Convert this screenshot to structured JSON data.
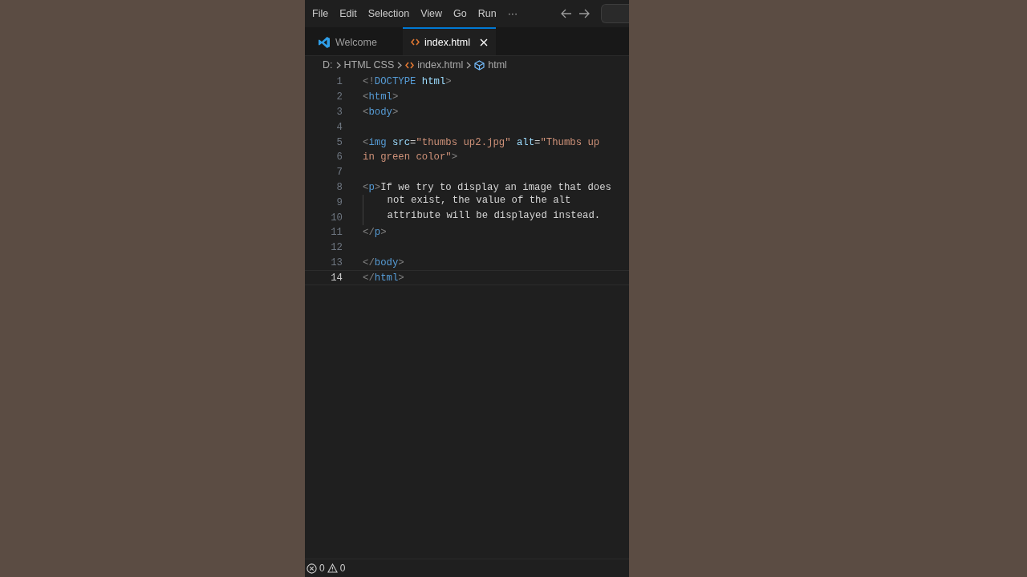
{
  "menu": [
    {
      "label": "File"
    },
    {
      "label": "Edit"
    },
    {
      "label": "Selection"
    },
    {
      "label": "View"
    },
    {
      "label": "Go"
    },
    {
      "label": "Run"
    },
    {
      "label": "···"
    }
  ],
  "tabs": [
    {
      "label": "Welcome",
      "kind": "welcome",
      "selected": false
    },
    {
      "label": "index.html",
      "kind": "html",
      "selected": true
    }
  ],
  "breadcrumb": [
    {
      "label": "D:",
      "kind": "folder"
    },
    {
      "label": "HTML CSS",
      "kind": "folder"
    },
    {
      "label": "index.html",
      "kind": "html"
    },
    {
      "label": "html",
      "kind": "element"
    }
  ],
  "lines": [
    {
      "number": "1",
      "current": false,
      "tokens": [
        {
          "kind": "bracket",
          "text": "<!"
        },
        {
          "kind": "tag",
          "text": "DOCTYPE"
        },
        {
          "kind": "attr",
          "text": " html"
        },
        {
          "kind": "bracket",
          "text": ">"
        }
      ]
    },
    {
      "number": "2",
      "current": false,
      "tokens": [
        {
          "kind": "bracket",
          "text": "<"
        },
        {
          "kind": "tag",
          "text": "html"
        },
        {
          "kind": "bracket",
          "text": ">"
        }
      ]
    },
    {
      "number": "3",
      "current": false,
      "tokens": [
        {
          "kind": "bracket",
          "text": "<"
        },
        {
          "kind": "tag",
          "text": "body"
        },
        {
          "kind": "bracket",
          "text": ">"
        }
      ]
    },
    {
      "number": "4",
      "current": false
    },
    {
      "number": "5",
      "current": false,
      "tokens": [
        {
          "kind": "bracket",
          "text": "<"
        },
        {
          "kind": "tag",
          "text": "img"
        },
        {
          "kind": "attr",
          "text": " src"
        },
        {
          "kind": "text",
          "text": "="
        },
        {
          "kind": "string",
          "text": "\"thumbs up2.jpg\""
        },
        {
          "kind": "attr",
          "text": " alt"
        },
        {
          "kind": "text",
          "text": "="
        },
        {
          "kind": "string",
          "text": "\"Thumbs up"
        }
      ]
    },
    {
      "number": "6",
      "current": false,
      "tokens": [
        {
          "kind": "string",
          "text": "in green color\""
        },
        {
          "kind": "bracket",
          "text": ">"
        }
      ]
    },
    {
      "number": "7",
      "current": false
    },
    {
      "number": "8",
      "current": false,
      "tokens": [
        {
          "kind": "bracket",
          "text": "<"
        },
        {
          "kind": "tag",
          "text": "p"
        },
        {
          "kind": "bracket",
          "text": ">"
        },
        {
          "kind": "text",
          "text": "If we try to display an image that does"
        }
      ]
    },
    {
      "number": "9",
      "current": false,
      "indented": true,
      "tokens": [
        {
          "kind": "text",
          "text": "not exist, the value of the alt"
        }
      ]
    },
    {
      "number": "10",
      "current": false,
      "indented": true,
      "tokens": [
        {
          "kind": "text",
          "text": "attribute will be displayed instead."
        }
      ]
    },
    {
      "number": "11",
      "current": false,
      "tokens": [
        {
          "kind": "bracket",
          "text": "</"
        },
        {
          "kind": "tag",
          "text": "p"
        },
        {
          "kind": "bracket",
          "text": ">"
        }
      ]
    },
    {
      "number": "12",
      "current": false
    },
    {
      "number": "13",
      "current": false,
      "tokens": [
        {
          "kind": "bracket",
          "text": "</"
        },
        {
          "kind": "tag",
          "text": "body"
        },
        {
          "kind": "bracket",
          "text": ">"
        }
      ]
    },
    {
      "number": "14",
      "current": true,
      "tokens": [
        {
          "kind": "bracket",
          "text": "</"
        },
        {
          "kind": "tag",
          "text": "html"
        },
        {
          "kind": "bracket",
          "text": ">"
        }
      ]
    }
  ],
  "status_bar": {
    "errors": "0",
    "warnings": "0"
  }
}
